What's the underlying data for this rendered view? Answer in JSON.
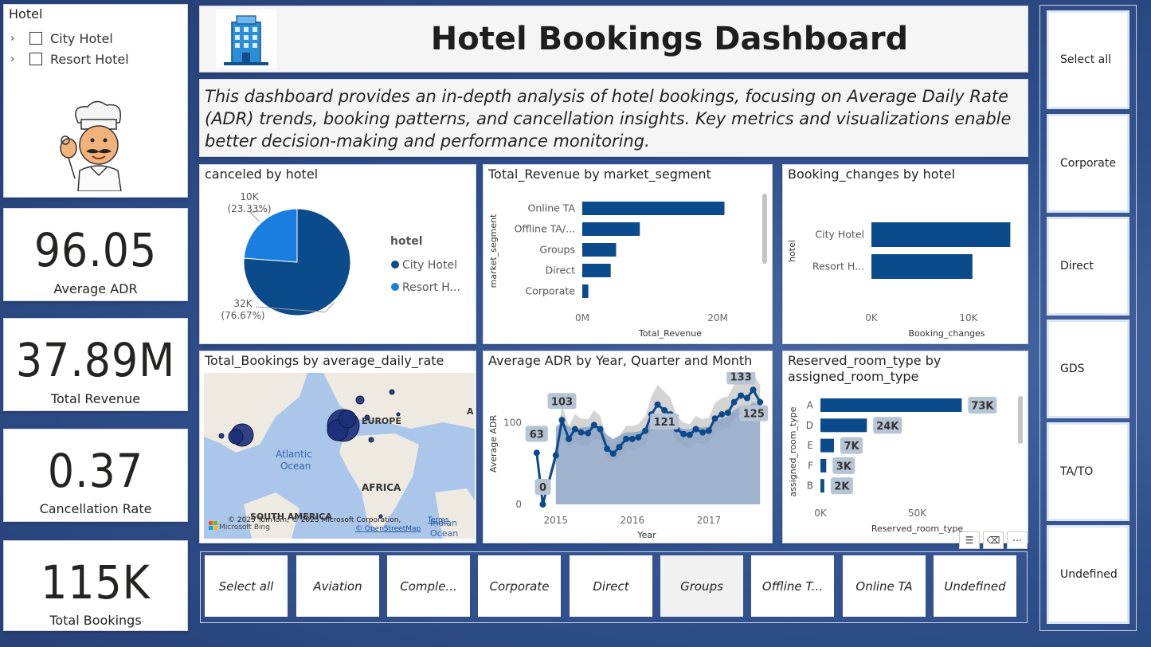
{
  "hotel_slicer": {
    "title": "Hotel",
    "items": [
      {
        "label": "City Hotel",
        "checked": false
      },
      {
        "label": "Resort Hotel",
        "checked": false
      }
    ]
  },
  "kpis": [
    {
      "value": "96.05",
      "label": "Average ADR"
    },
    {
      "value": "37.89M",
      "label": "Total Revenue"
    },
    {
      "value": "0.37",
      "label": "Cancellation Rate"
    },
    {
      "value": "115K",
      "label": "Total Bookings"
    }
  ],
  "header": {
    "title": "Hotel Bookings Dashboard",
    "logo_icon": "hotel-building-icon",
    "description": "This dashboard provides an in-depth analysis of hotel bookings, focusing on Average Daily Rate (ADR) trends, booking patterns, and cancellation insights. Key metrics and visualizations enable better decision-making and performance monitoring."
  },
  "visuals": {
    "canceled": {
      "title": "canceled by hotel"
    },
    "revenue": {
      "title": "Total_Revenue by market_segment"
    },
    "changes": {
      "title": "Booking_changes by hotel"
    },
    "map": {
      "title": "Total_Bookings by average_daily_rate",
      "labels": {
        "europe": "EUROPE",
        "atlantic1": "Atlantic",
        "atlantic2": "Ocean",
        "africa": "AFRICA",
        "south_america": "SOUTH AMERICA",
        "indian1": "Indian",
        "indian2": "Ocean",
        "edge": "A"
      },
      "attribution": "© 2025 TomTom, © 2025 Microsoft Corporation,",
      "terms": "Terms",
      "osm": "© OpenStreetMap",
      "bing": "Microsoft Bing"
    },
    "adr": {
      "title": "Average ADR by Year, Quarter and Month"
    },
    "room": {
      "title": "Reserved_room_type by assigned_room_type"
    }
  },
  "chart_data": [
    {
      "id": "canceled",
      "type": "pie",
      "legend_title": "hotel",
      "legend_position": "right",
      "slices": [
        {
          "name": "City Hotel",
          "legend_label": "City Hotel",
          "value": 32000,
          "label": "32K",
          "pct_label": "(76.67%)",
          "color": "#0b4a8b"
        },
        {
          "name": "Resort Hotel",
          "legend_label": "Resort H...",
          "value": 10000,
          "label": "10K",
          "pct_label": "(23.33%)",
          "color": "#1a7ee0"
        }
      ]
    },
    {
      "id": "revenue",
      "type": "bar",
      "orientation": "horizontal",
      "categories": [
        "Online TA",
        "Offline TA/...",
        "Groups",
        "Direct",
        "Corporate"
      ],
      "values": [
        21000000,
        8500000,
        5000000,
        4200000,
        900000
      ],
      "xlabel": "Total_Revenue",
      "ylabel": "market_segment",
      "xlim": [
        0,
        26000000
      ],
      "xticks": [
        {
          "value": 0,
          "label": "0M"
        },
        {
          "value": 20000000,
          "label": "20M"
        }
      ],
      "color": "#0b4a8b"
    },
    {
      "id": "changes",
      "type": "bar",
      "orientation": "horizontal",
      "categories": [
        "City Hotel",
        "Resort H..."
      ],
      "values": [
        14300,
        10400
      ],
      "xlabel": "Booking_changes",
      "ylabel": "hotel",
      "xlim": [
        0,
        15500
      ],
      "xticks": [
        {
          "value": 0,
          "label": "0K"
        },
        {
          "value": 10000,
          "label": "10K"
        }
      ],
      "color": "#0b4a8b"
    },
    {
      "id": "adr",
      "type": "line",
      "xlabel": "Year",
      "ylabel": "Average ADR",
      "ylim": [
        0,
        150
      ],
      "yticks": [
        0,
        100
      ],
      "x_ticks": [
        {
          "value": 2015,
          "label": "2015"
        },
        {
          "value": 2016,
          "label": "2016"
        },
        {
          "value": 2017,
          "label": "2017"
        }
      ],
      "x": [
        2014.75,
        2014.83,
        2015.0,
        2015.08,
        2015.17,
        2015.25,
        2015.33,
        2015.42,
        2015.5,
        2015.58,
        2015.67,
        2015.75,
        2015.83,
        2015.92,
        2016.0,
        2016.08,
        2016.17,
        2016.25,
        2016.33,
        2016.42,
        2016.5,
        2016.58,
        2016.67,
        2016.75,
        2016.83,
        2016.92,
        2017.0,
        2017.08,
        2017.17,
        2017.25,
        2017.33,
        2017.42,
        2017.5,
        2017.58,
        2017.67
      ],
      "y": [
        63,
        0,
        60,
        103,
        80,
        92,
        88,
        87,
        97,
        92,
        68,
        62,
        70,
        80,
        80,
        82,
        90,
        110,
        122,
        115,
        110,
        92,
        86,
        85,
        92,
        88,
        90,
        105,
        110,
        112,
        125,
        133,
        130,
        140,
        125
      ],
      "band_low": [
        60,
        0,
        50,
        85,
        70,
        75,
        72,
        72,
        80,
        78,
        58,
        52,
        58,
        66,
        66,
        68,
        74,
        90,
        100,
        96,
        92,
        78,
        72,
        70,
        76,
        74,
        76,
        88,
        92,
        94,
        104,
        112,
        110,
        118,
        105
      ],
      "band_high": [
        66,
        4,
        70,
        121,
        96,
        110,
        105,
        104,
        115,
        108,
        80,
        74,
        84,
        96,
        96,
        98,
        108,
        132,
        146,
        138,
        130,
        108,
        100,
        98,
        108,
        104,
        106,
        124,
        130,
        132,
        146,
        152,
        150,
        160,
        146
      ],
      "area": [
        null,
        null,
        95,
        100,
        95,
        92,
        94,
        95,
        97,
        95,
        85,
        80,
        84,
        88,
        88,
        89,
        92,
        100,
        105,
        102,
        100,
        95,
        92,
        92,
        95,
        94,
        95,
        102,
        105,
        108,
        115,
        120,
        118,
        125,
        120
      ],
      "data_labels": [
        {
          "index": 0,
          "label": "63"
        },
        {
          "index": 1,
          "label": "0"
        },
        {
          "index": 3,
          "label": "103"
        },
        {
          "index": 19,
          "label": "121"
        },
        {
          "index": 31,
          "label": "133"
        },
        {
          "index": 34,
          "label": "125"
        }
      ],
      "color": "#0b4a8b"
    },
    {
      "id": "room",
      "type": "bar",
      "orientation": "horizontal",
      "categories": [
        "A",
        "D",
        "E",
        "F",
        "B"
      ],
      "values": [
        73000,
        24000,
        7000,
        3000,
        2000
      ],
      "value_labels": [
        "73K",
        "24K",
        "7K",
        "3K",
        "2K"
      ],
      "xlabel": "Reserved_room_type",
      "ylabel": "assigned_room_type",
      "xlim": [
        0,
        100000
      ],
      "xticks": [
        {
          "value": 0,
          "label": "0K"
        },
        {
          "value": 50000,
          "label": "50K"
        }
      ],
      "color": "#0b4a8b"
    }
  ],
  "segment_slicer": {
    "buttons": [
      "Select all",
      "Aviation",
      "Comple...",
      "Corporate",
      "Direct",
      "Groups",
      "Offline T...",
      "Online TA",
      "Undefined"
    ],
    "selected": "Groups"
  },
  "channel_slicer": {
    "buttons": [
      "Select all",
      "Corporate",
      "Direct",
      "GDS",
      "TA/TO",
      "Undefined"
    ]
  },
  "visual_header_icons": [
    "filter-icon",
    "eraser-icon",
    "more-options-icon"
  ]
}
